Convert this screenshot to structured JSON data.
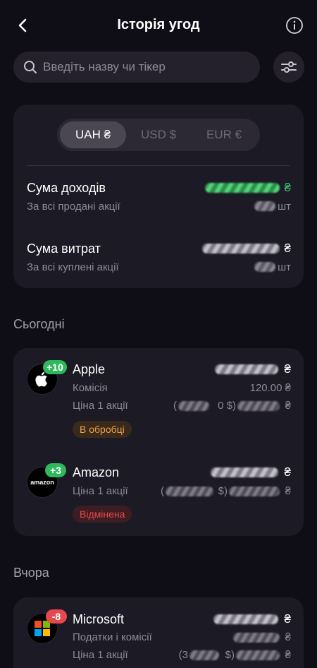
{
  "header": {
    "title": "Історія угод",
    "back_icon": "chevron-left-icon",
    "info_icon": "info-icon"
  },
  "search": {
    "placeholder": "Введіть назву чи тікер",
    "value": ""
  },
  "currency_tabs": [
    "UAH ₴",
    "USD $",
    "EUR €"
  ],
  "selected_currency": "UAH ₴",
  "summary": {
    "income": {
      "title": "Сума доходів",
      "subtitle": "За всі продані акції",
      "currency": "₴",
      "unit": "шт"
    },
    "expenses": {
      "title": "Сума витрат",
      "subtitle": "За всі куплені акції",
      "currency": "₴",
      "unit": "шт"
    }
  },
  "sections": {
    "today": "Сьогодні",
    "yesterday": "Вчора"
  },
  "trades": {
    "apple": {
      "name": "Apple",
      "badge": "+10",
      "commission_label": "Комісія",
      "price_label": "Ціна 1 акції",
      "currency": "₴",
      "commission_value": "120.00 ₴",
      "price_open": "(",
      "price_usd": "0 $)",
      "status": "В обробці"
    },
    "amazon": {
      "name": "Amazon",
      "badge": "+3",
      "price_label": "Ціна 1 акції",
      "currency": "₴",
      "price_open": "(",
      "price_usd": "$)",
      "status": "Відмінена",
      "logo_text": "amazon"
    },
    "microsoft": {
      "name": "Microsoft",
      "badge": "-8",
      "taxes_label": "Податки і комісії",
      "price_label": "Ціна 1 акції",
      "currency": "₴",
      "price_open": "(3",
      "price_usd": "$)"
    }
  },
  "colors": {
    "background": "#0f0d16",
    "card": "#1c1a24",
    "income_green": "#3ec46d",
    "status_processing": "#f0a04b",
    "status_cancelled": "#e5484d",
    "badge_green": "#2fb85c",
    "badge_red": "#e5484d"
  }
}
